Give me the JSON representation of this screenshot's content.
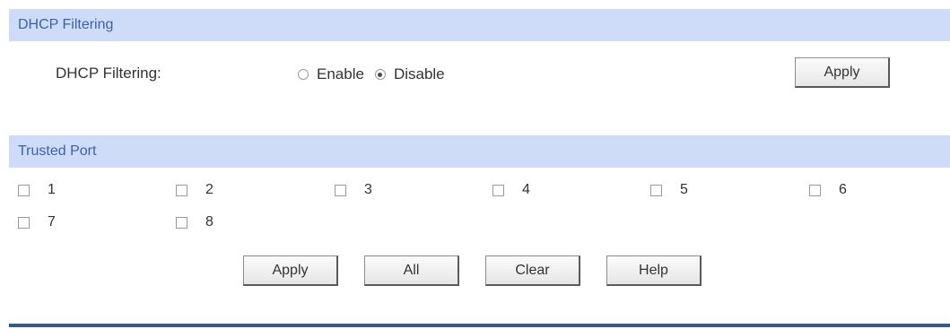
{
  "dhcp_filtering": {
    "header": "DHCP Filtering",
    "label": "DHCP Filtering:",
    "options": [
      {
        "label": "Enable",
        "selected": false
      },
      {
        "label": "Disable",
        "selected": true
      }
    ],
    "apply_label": "Apply"
  },
  "trusted_port": {
    "header": "Trusted Port",
    "ports": [
      {
        "label": "1",
        "checked": false
      },
      {
        "label": "2",
        "checked": false
      },
      {
        "label": "3",
        "checked": false
      },
      {
        "label": "4",
        "checked": false
      },
      {
        "label": "5",
        "checked": false
      },
      {
        "label": "6",
        "checked": false
      },
      {
        "label": "7",
        "checked": false
      },
      {
        "label": "8",
        "checked": false
      }
    ],
    "buttons": {
      "apply": "Apply",
      "all": "All",
      "clear": "Clear",
      "help": "Help"
    }
  },
  "colors": {
    "header_bg": "#cfdcf8",
    "header_text": "#3a62a8",
    "bottom_line": "#2f5c8a"
  }
}
